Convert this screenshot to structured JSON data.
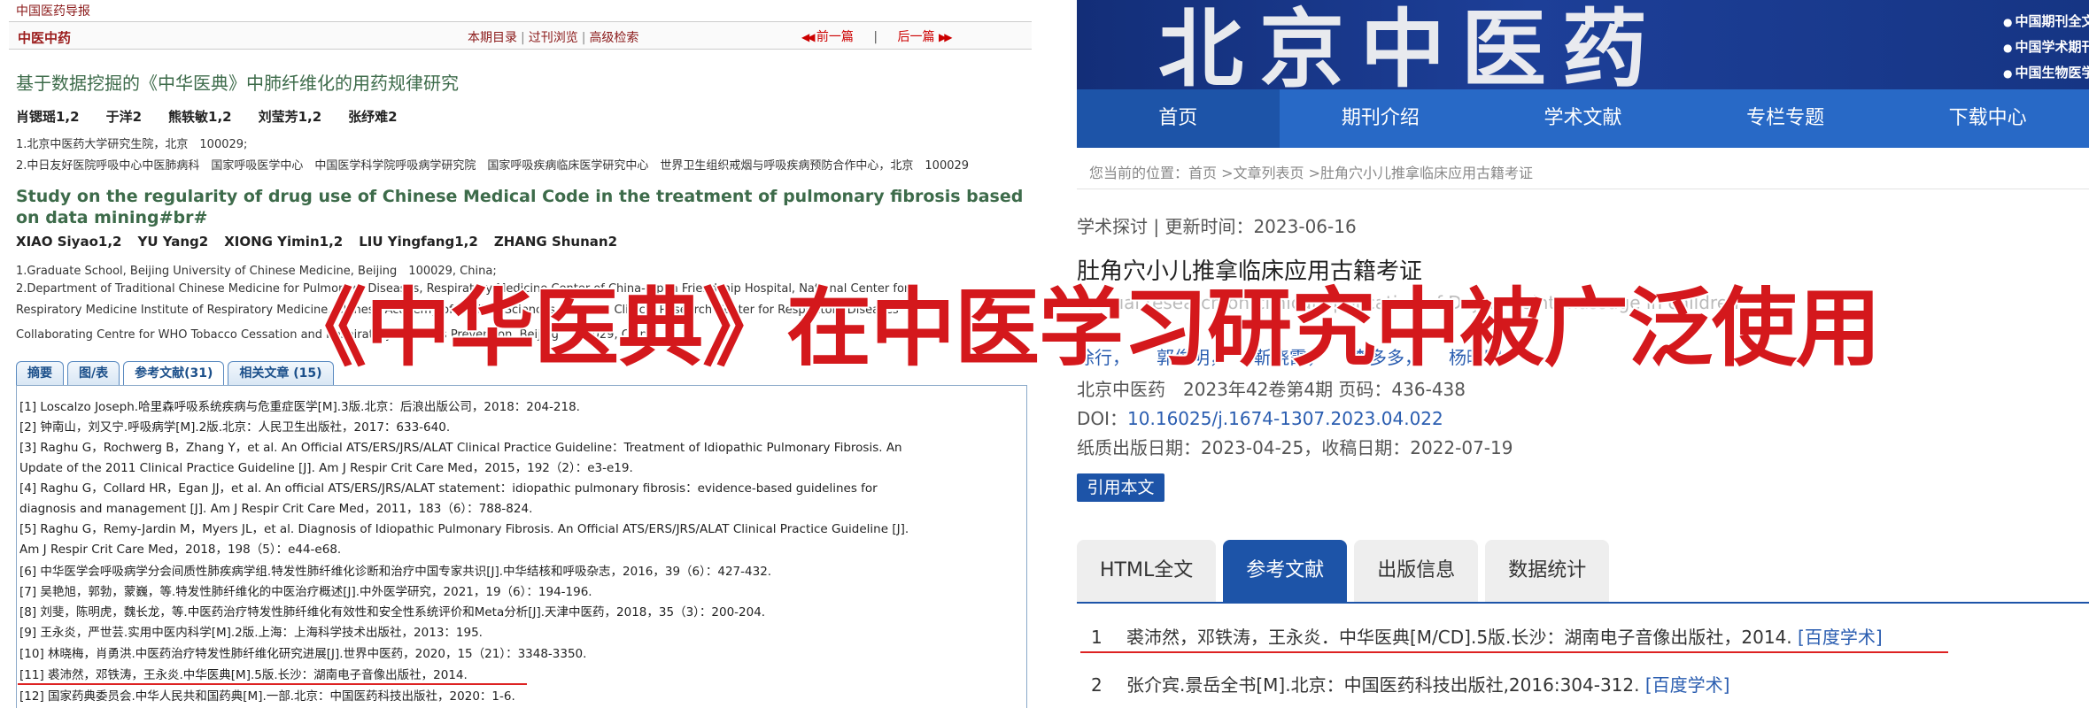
{
  "left": {
    "site_name": "中国医药导报",
    "journal_name": "中医中药",
    "links": [
      "本期目录",
      "过刊浏览",
      "高级检索"
    ],
    "prev_label": "前一篇",
    "next_label": "后一篇",
    "title_cn": "基于数据挖掘的《中华医典》中肺纤维化的用药规律研究",
    "authors_cn": [
      "肖锶瑶1,2",
      "于洋2",
      "熊轶敏1,2",
      "刘莹芳1,2",
      "张纾难2"
    ],
    "affiliations_cn": [
      "1.北京中医药大学研究生院，北京　100029;",
      "2.中日友好医院呼吸中心中医肺病科　国家呼吸医学中心　中国医学科学院呼吸病学研究院　国家呼吸疾病临床医学研究中心　世界卫生组织戒烟与呼吸疾病预防合作中心，北京　100029"
    ],
    "title_en": "Study on the regularity of drug use of Chinese Medical Code in the treatment of pulmonary fibrosis based on data mining#br#",
    "authors_en": [
      "XIAO Siyao1,2",
      "YU Yang2",
      "XIONG Yimin1,2",
      "LIU Yingfang1,2",
      "ZHANG Shunan2"
    ],
    "affiliations_en": [
      "1.Graduate School, Beijing University of Chinese Medicine, Beijing　100029, China;",
      "2.Department of Traditional Chinese Medicine for Pulmonary Diseases, Respiratory Medicine Center of China-Japan Friendship Hospital, National Center for",
      "Respiratory Medicine  Institute of Respiratory Medicine, Chinese Academy of Medical Sciences, National Clinical Research Center for Respiratory Diseases",
      "Collaborating Centre for WHO Tobacco Cessation and Respiratory Diseases Prevention, Beijing　100029, China"
    ],
    "tabs": [
      "摘要",
      "图/表",
      "参考文献(31)",
      "相关文章 (15)"
    ],
    "references": [
      "[1]  Loscalzo Joseph.哈里森呼吸系统疾病与危重症医学[M].3版.北京：后浪出版公司，2018：204-218.",
      "[2]  钟南山，刘又宁.呼吸病学[M].2版.北京：人民卫生出版社，2017：633-640.",
      "[3]  Raghu G，Rochwerg B，Zhang Y，et al. An Official ATS/ERS/JRS/ALAT Clinical Practice Guideline：Treatment of Idiopathic Pulmonary Fibrosis. An",
      "Update of the 2011 Clinical Practice Guideline [J]. Am J Respir Crit Care Med，2015，192（2）：e3-e19.",
      "[4]  Raghu G，Collard HR，Egan JJ，et al. An official ATS/ERS/JRS/ALAT statement：idiopathic pulmonary fibrosis：evidence-based guidelines for",
      "diagnosis and management [J]. Am J Respir Crit Care Med，2011，183（6）：788-824.",
      "[5]  Raghu G，Remy-Jardin M，Myers JL，et al. Diagnosis of Idiopathic Pulmonary Fibrosis. An Official ATS/ERS/JRS/ALAT Clinical Practice Guideline [J].",
      "Am J Respir Crit Care Med，2018，198（5）：e44-e68.",
      "[6]  中华医学会呼吸病学分会间质性肺疾病学组.特发性肺纤维化诊断和治疗中国专家共识[J].中华结核和呼吸杂志，2016，39（6）：427-432.",
      "[7]  吴艳旭，郭勃，蒙巍，等.特发性肺纤维化的中医治疗概述[J].中外医学研究，2021，19（6）：194-196.",
      "[8]  刘斐，陈明虎，魏长龙，等.中医药治疗特发性肺纤维化有效性和安全性系统评价和Meta分析[J].天津中医药，2018，35（3）：200-204.",
      "[9]  王永炎，严世芸.实用中医内科学[M].2版.上海：上海科学技术出版社，2013：195.",
      "[10]  林晓梅，肖勇洪.中医药治疗特发性肺纤维化研究进展[J].世界中医药，2020，15（21）：3348-3350.",
      "[11]  裘沛然，邓铁涛，王永炎.中华医典[M].5版.长沙：湖南电子音像出版社，2014.",
      "[12]  国家药典委员会.中华人民共和国药典[M].一部.北京：中国医药科技出版社，2020：1-6."
    ]
  },
  "right": {
    "banner_title": "北京中医药",
    "banner_items": [
      "中国期刊全文数",
      "中国学术期刊综",
      "中国生物医学文"
    ],
    "nav": [
      "首页",
      "期刊介绍",
      "学术文献",
      "专栏专题",
      "下载中心"
    ],
    "breadcrumb": "您当前的位置：首页 >文章列表页 >肚角穴小儿推拿临床应用古籍考证",
    "meta": "学术探讨 | 更新时间：2023-06-16",
    "title": "肚角穴小儿推拿临床应用古籍考证",
    "subtitle": "Textual research on clinical application of Dujiao point massage in children",
    "authors": [
      "徐行，",
      "郭俊明，",
      "靳晓霞，",
      "李多多，",
      "杨晓明"
    ],
    "pub": "北京中医药　2023年42卷第4期 页码：436-438",
    "doi_label": "DOI：",
    "doi": "10.16025/j.1674-1307.2023.04.022",
    "dates": "纸质出版日期：2023-04-25，收稿日期：2022-07-19",
    "cite_button": "引用本文",
    "tabs": [
      "HTML全文",
      "参考文献",
      "出版信息",
      "数据统计"
    ],
    "references": [
      {
        "num": "1",
        "text": "裘沛然，邓铁涛，王永炎．中华医典[M/CD].5版.长沙：湖南电子音像出版社，2014. ",
        "link": "[百度学术]"
      },
      {
        "num": "2",
        "text": "张介宾.景岳全书[M].北京：中国医药科技出版社,2016:304-312. ",
        "link": "[百度学术]"
      }
    ]
  },
  "overlay_text": "《中华医典》在中医学习研究中被广泛使用",
  "colors": {
    "accent_red": "#d4181c",
    "nav_blue": "#2869c6",
    "active_blue": "#1d54a8",
    "heading_green": "#3d6b4a"
  }
}
